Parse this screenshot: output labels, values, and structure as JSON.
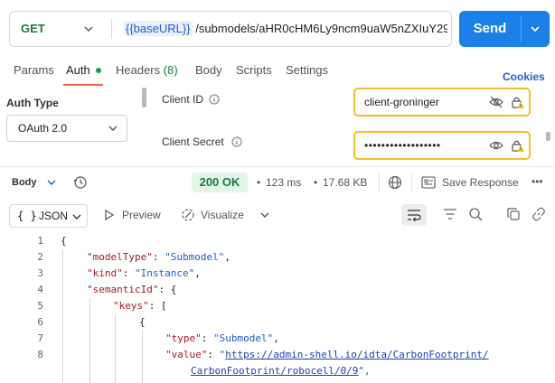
{
  "request": {
    "method": "GET",
    "url_variable": "{{baseURL}}",
    "url_path": "/submodels/aHR0cHM6Ly9ncm9uaW5nZXIuY29…",
    "send_label": "Send"
  },
  "tabs": [
    {
      "label": "Params"
    },
    {
      "label": "Auth"
    },
    {
      "label": "Headers",
      "count": "(8)"
    },
    {
      "label": "Body"
    },
    {
      "label": "Scripts"
    },
    {
      "label": "Settings"
    }
  ],
  "cookies_label": "Cookies",
  "auth": {
    "type_label": "Auth Type",
    "type_value": "OAuth 2.0",
    "client_id_label": "Client ID",
    "client_id_value": "client-groninger",
    "client_secret_label": "Client Secret",
    "client_secret_value": "••••••••••••••••••"
  },
  "response": {
    "body_label": "Body",
    "status": "200 OK",
    "time": "123 ms",
    "size": "17.68 KB",
    "save_label": "Save Response",
    "more": "•••"
  },
  "viewer": {
    "format_icon": "{ }",
    "format_label": "JSON",
    "preview_label": "Preview",
    "visualize_label": "Visualize"
  },
  "code": {
    "line_numbers": [
      "1",
      "2",
      "3",
      "4",
      "5",
      "6",
      "7",
      "8"
    ],
    "brace_open": "{",
    "k_modelType": "\"modelType\"",
    "v_modelType": "\"Submodel\"",
    "k_kind": "\"kind\"",
    "v_kind": "\"Instance\"",
    "k_semanticId": "\"semanticId\"",
    "k_keys": "\"keys\"",
    "k_type": "\"type\"",
    "v_type": "\"Submodel\"",
    "k_value": "\"value\"",
    "v_value_1": "https://admin-shell.io/idta/CarbonFootprint/",
    "v_value_2": "CarbonFootprint/robocell/0/9",
    "v_value_close": "\","
  },
  "colors": {
    "accent": "#1a7fe6",
    "tab_underline": "#f26b3a",
    "status_green": "#1a7a3c",
    "warning_border": "#f0c02c"
  }
}
